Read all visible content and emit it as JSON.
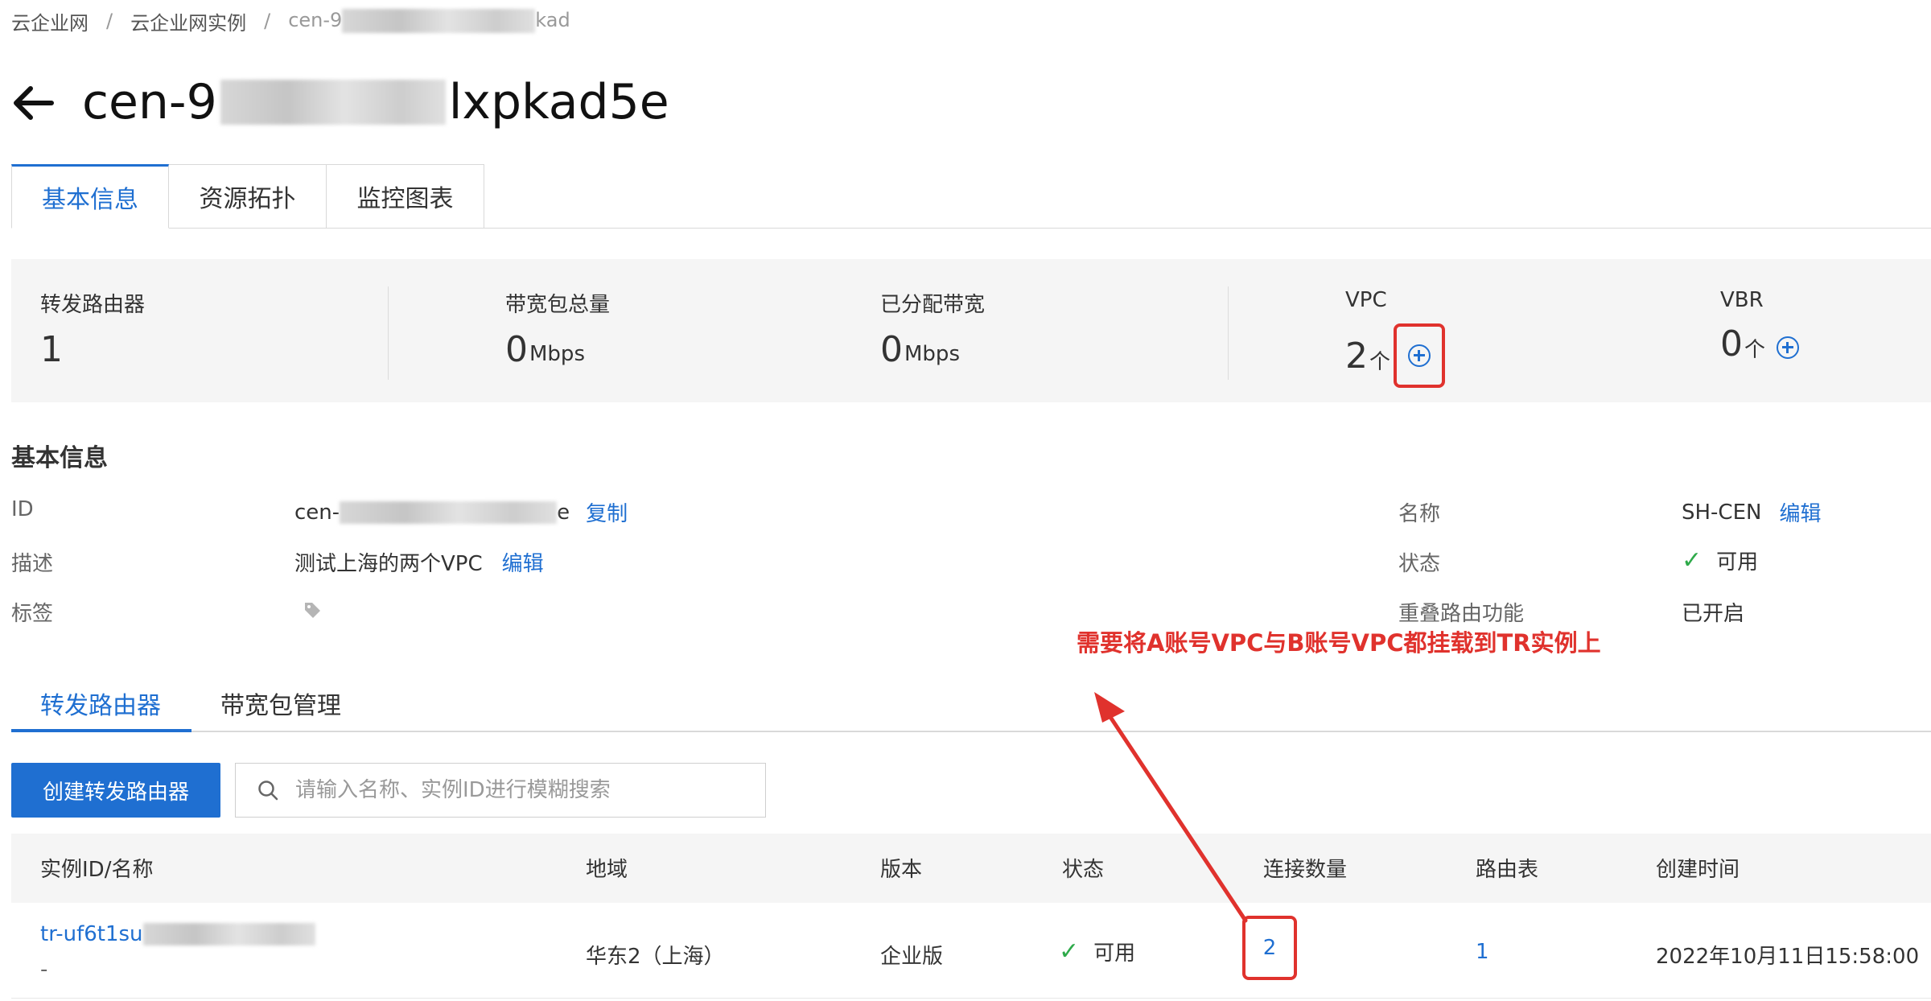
{
  "breadcrumb": {
    "items": [
      "云企业网",
      "云企业网实例"
    ],
    "separator": "/",
    "current_prefix": "cen-9",
    "current_suffix": "kad"
  },
  "page": {
    "title_prefix": "cen-9",
    "title_suffix": "lxpkad5e"
  },
  "tabs": [
    "基本信息",
    "资源拓扑",
    "监控图表"
  ],
  "stats": {
    "forwarder": {
      "label": "转发路由器",
      "value": "1"
    },
    "bandwidth_total": {
      "label": "带宽包总量",
      "value": "0",
      "unit": "Mbps"
    },
    "bandwidth_allocated": {
      "label": "已分配带宽",
      "value": "0",
      "unit": "Mbps"
    },
    "vpc": {
      "label": "VPC",
      "value": "2",
      "unit": "个"
    },
    "vbr": {
      "label": "VBR",
      "value": "0",
      "unit": "个"
    }
  },
  "basic_info": {
    "title": "基本信息",
    "id": {
      "label": "ID",
      "prefix": "cen-",
      "suffix": "e",
      "action": "复制"
    },
    "description": {
      "label": "描述",
      "value": "测试上海的两个VPC",
      "action": "编辑"
    },
    "tags": {
      "label": "标签"
    },
    "name": {
      "label": "名称",
      "value": "SH-CEN",
      "action": "编辑"
    },
    "status": {
      "label": "状态",
      "value": "可用"
    },
    "overlap_routing": {
      "label": "重叠路由功能",
      "value": "已开启"
    }
  },
  "annotation": "需要将A账号VPC与B账号VPC都挂载到TR实例上",
  "subtabs": [
    "转发路由器",
    "带宽包管理"
  ],
  "toolbar": {
    "create_label": "创建转发路由器",
    "search_placeholder": "请输入名称、实例ID进行模糊搜索"
  },
  "table": {
    "columns": [
      "实例ID/名称",
      "地域",
      "版本",
      "状态",
      "连接数量",
      "路由表",
      "创建时间"
    ],
    "rows": [
      {
        "id_prefix": "tr-uf6t1su",
        "name": "-",
        "region": "华东2（上海）",
        "edition": "企业版",
        "status": "可用",
        "connections": "2",
        "route_tables": "1",
        "created": "2022年10月11日15:58:00"
      }
    ]
  },
  "colors": {
    "accent": "#1f6fd1",
    "highlight": "#e0322d",
    "success": "#2eaa4a"
  }
}
